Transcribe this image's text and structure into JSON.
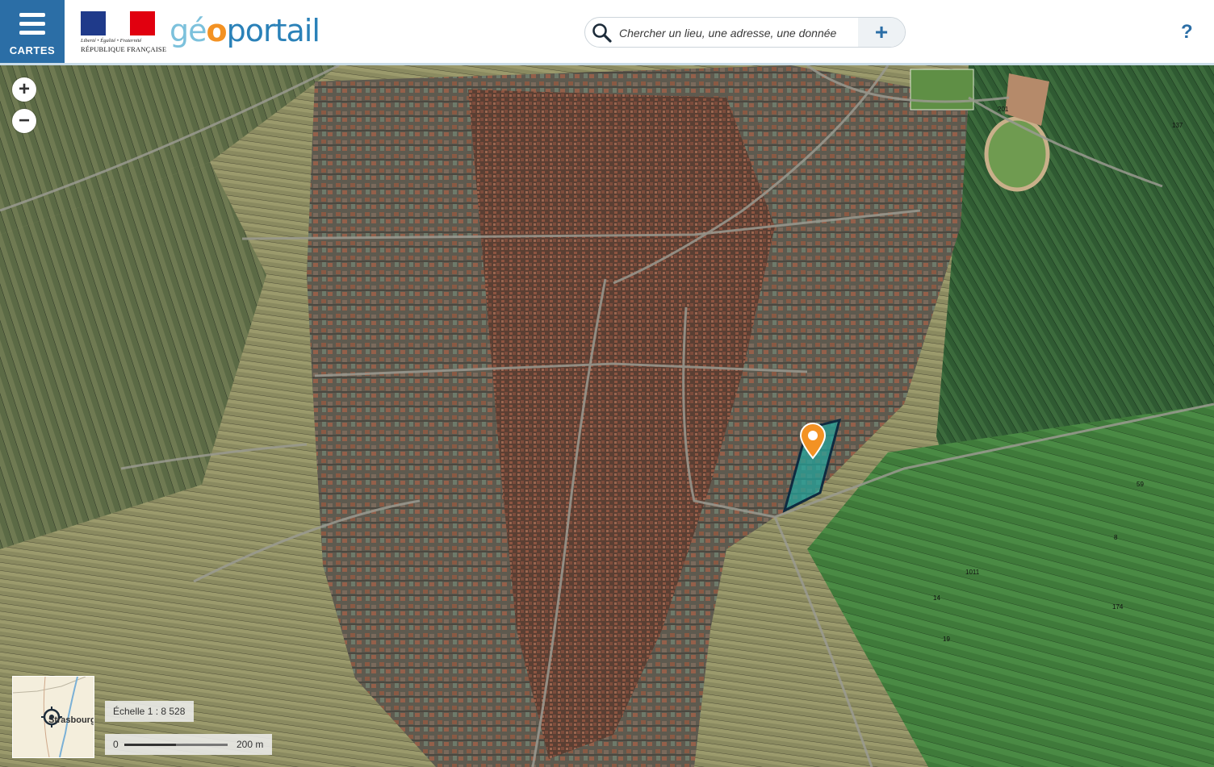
{
  "header": {
    "menu_label": "CARTES",
    "rf_motto": "Liberté • Égalité • Fraternité",
    "rf_name": "RÉPUBLIQUE FRANÇAISE",
    "brand_ge": "gé",
    "brand_o": "o",
    "brand_portail": "portail",
    "help_label": "?"
  },
  "search": {
    "placeholder": "Chercher un lieu, une adresse, une donnée",
    "plus_label": "+"
  },
  "map": {
    "zoom_in": "+",
    "zoom_out": "−",
    "minimap_city": "Strasbourg",
    "scale_text": "Échelle 1 : 8 528",
    "scalebar_zero": "0",
    "scalebar_distance": "200 m",
    "parcel_labels": [
      "59",
      "8",
      "137",
      "201",
      "14",
      "1011",
      "19",
      "174"
    ]
  },
  "colors": {
    "menu_blue": "#2b6ea6",
    "brand_light": "#7cc1dc",
    "brand_orange": "#f39223",
    "brand_blue": "#2a81b8",
    "parcel_highlight": "#1fa7a0",
    "pin_orange": "#f39223"
  }
}
